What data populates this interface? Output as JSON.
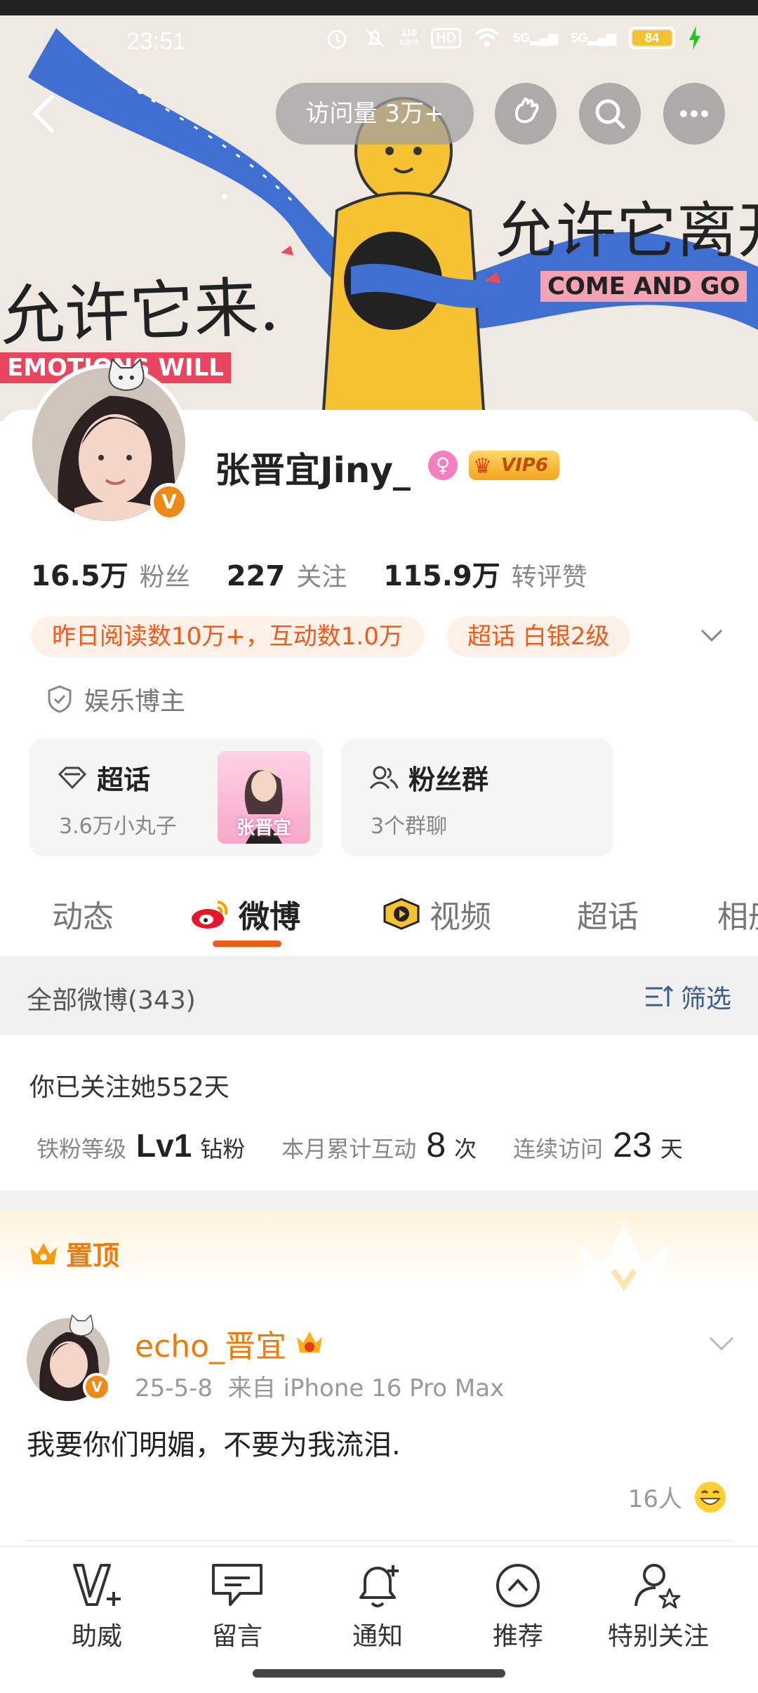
{
  "status_bar": {
    "time": "23:51",
    "network_speed_value": "110",
    "network_speed_unit": "KB/S",
    "hd_label": "HD",
    "signal1": "5G",
    "signal2": "5G",
    "battery": "84"
  },
  "header": {
    "visits": "访问量 3万+"
  },
  "banner": {
    "text_left": "允许它来.",
    "text_left_sub": "EMOTIONS WILL",
    "text_right": "允许它离开",
    "text_right_sub": "COME AND GO"
  },
  "profile": {
    "name": "张晋宜Jiny_",
    "vip_label": "VIP6",
    "verified_badge": "V",
    "stats": [
      {
        "num": "16.5万",
        "label": "粉丝"
      },
      {
        "num": "227",
        "label": "关注"
      },
      {
        "num": "115.9万",
        "label": "转评赞"
      }
    ],
    "tags": [
      "昨日阅读数10万+，互动数1.0万",
      "超话 白银2级"
    ],
    "category": "娱乐博主"
  },
  "features": {
    "chaohua": {
      "title": "超话",
      "sub": "3.6万小丸子",
      "thumb_text": "张晋宜"
    },
    "fan_group": {
      "title": "粉丝群",
      "sub": "3个群聊"
    }
  },
  "tabs": [
    {
      "label": "动态"
    },
    {
      "label": "微博"
    },
    {
      "label": "视频"
    },
    {
      "label": "超话"
    },
    {
      "label": "相册"
    }
  ],
  "all_posts": {
    "label": "全部微博(343)",
    "filter_label": "筛选"
  },
  "follow": {
    "days": "你已关注她552天",
    "fan_level_label": "铁粉等级",
    "fan_level_value": "Lv1",
    "fan_level_suffix": "钻粉",
    "interact_label": "本月累计互动",
    "interact_value": "8",
    "interact_unit": "次",
    "visit_label": "连续访问",
    "visit_value": "23",
    "visit_unit": "天"
  },
  "pinned": {
    "label": "置顶"
  },
  "post": {
    "author": "echo_晋宜",
    "date": "25-5-8",
    "source": "来自 iPhone 16 Pro Max",
    "text": "我要你们明媚，不要为我流泪.",
    "reactions": "16人"
  },
  "bottom_bar": [
    {
      "label": "助威",
      "icon": "v-plus-icon"
    },
    {
      "label": "留言",
      "icon": "message-icon"
    },
    {
      "label": "通知",
      "icon": "bell-icon"
    },
    {
      "label": "推荐",
      "icon": "up-arrow-circle-icon"
    },
    {
      "label": "特别关注",
      "icon": "user-star-icon"
    }
  ],
  "colors": {
    "accent": "#f05a1a",
    "orange": "#f07a0a",
    "link_blue": "#3e5d8a",
    "banner_river": "#3f6fd1",
    "banner_figure": "#f6c232"
  }
}
